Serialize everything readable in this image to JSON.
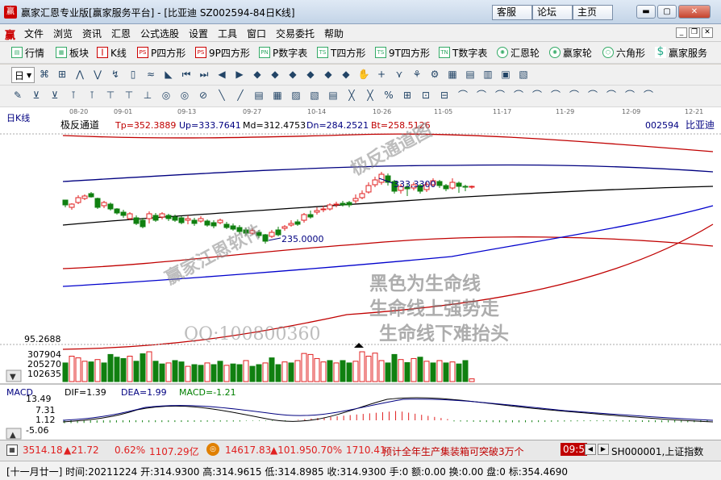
{
  "window": {
    "title": "赢家汇恩专业版[赢家服务平台] - [比亚迪  SZ002594-84日K线]",
    "nav": [
      "客服",
      "论坛",
      "主页"
    ],
    "logo": "赢"
  },
  "menu": [
    "文件",
    "浏览",
    "资讯",
    "汇恩",
    "公式选股",
    "设置",
    "工具",
    "窗口",
    "交易委托",
    "帮助"
  ],
  "toolbar1": [
    "行情",
    "板块",
    "K线",
    "P四方形",
    "9P四方形",
    "P数字表",
    "T四方形",
    "9T四方形",
    "T数字表",
    "汇恩轮",
    "赢家轮",
    "六角形",
    "赢家服务"
  ],
  "toolbar1_icons": [
    "PS",
    "PS",
    "PN",
    "TS",
    "TS",
    "TN"
  ],
  "toolbar2": {
    "first": "日"
  },
  "dates": [
    "08-20",
    "09-01",
    "09-13",
    "09-27",
    "10-14",
    "10-26",
    "11-05",
    "11-17",
    "11-29",
    "12-09",
    "12-21"
  ],
  "chart_label": "日K线",
  "indicator": {
    "name": "极反通道",
    "Tp": "Tp=352.3889",
    "Up": "Up=333.7641",
    "Md": "Md=312.4753",
    "Dn": "Dn=284.2521",
    "Bt": "Bt=258.5126",
    "code": "002594",
    "stock": "比亚迪"
  },
  "price_annotations": {
    "high": "333.3300",
    "low": "235.0000"
  },
  "watermarks": {
    "w1": "赢家江恩软件",
    "w2": "极反通道图",
    "w3": "黑色为生命线",
    "w4": "生命线上强势走",
    "w5": "生命线下难抬头",
    "qq": "QQ:100800360"
  },
  "volume": {
    "max": "95.2688",
    "ticks": [
      "307904",
      "205270",
      "102635"
    ]
  },
  "macd": {
    "name": "MACD",
    "DIF": "DIF=1.39",
    "DEA": "DEA=1.99",
    "MACD": "MACD=-1.21",
    "ticks": [
      "13.49",
      "7.31",
      "1.12",
      "-5.06"
    ]
  },
  "status": {
    "idx1": "3514.18",
    "idx1_chg": "▲21.72",
    "idx1_pct": "0.62%",
    "idx1_amt": "1107.29亿",
    "idx2": "14617.83",
    "idx2_chg": "▲101.95",
    "idx2_pct": "0.70%",
    "idx2_amt": "1710.41",
    "news": "预计全年生产集装箱可突破3万个",
    "time": "09:5",
    "index_name": "SH000001,上证指数"
  },
  "info_line": "[十一月廿一] 时间:20211224 开:314.9300 高:314.9615 低:314.8985 收:314.9300 手:0 额:0.00 换:0.00 盘:0 标:354.4690",
  "colors": {
    "up": "#e02020",
    "down": "#108010",
    "accent": "#c00000"
  }
}
